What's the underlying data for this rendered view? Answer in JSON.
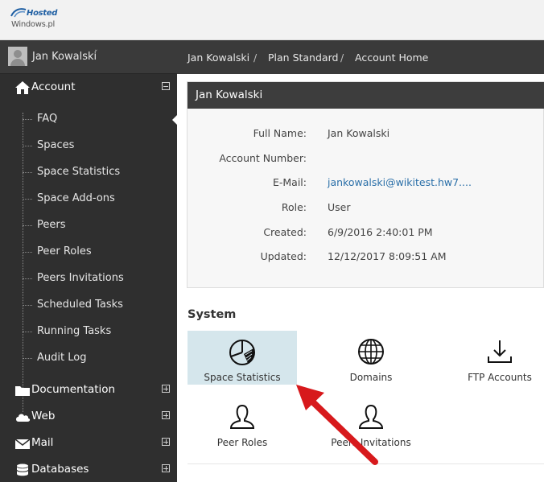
{
  "logo": {
    "line1": "Hosted",
    "line2": "Windows.pl"
  },
  "user": {
    "name": "Jan Kowalski",
    "caret": "ˇ"
  },
  "sidebar": {
    "account": {
      "label": "Account",
      "items": [
        "FAQ",
        "Spaces",
        "Space Statistics",
        "Space Add-ons",
        "Peers",
        "Peer Roles",
        "Peers Invitations",
        "Scheduled Tasks",
        "Running Tasks",
        "Audit Log"
      ]
    },
    "documentation": "Documentation",
    "web": "Web",
    "mail": "Mail",
    "databases": "Databases"
  },
  "breadcrumb": {
    "c1": "Jan Kowalski",
    "c2": "Plan Standard",
    "c3": "Account Home",
    "sep": "/"
  },
  "panel": {
    "title": "Jan Kowalski",
    "fields": [
      {
        "label": "Full Name:",
        "value": "Jan Kowalski"
      },
      {
        "label": "Account Number:",
        "value": ""
      },
      {
        "label": "E-Mail:",
        "value": "jankowalski@wikitest.hw7...."
      },
      {
        "label": "Role:",
        "value": "User"
      },
      {
        "label": "Created:",
        "value": "6/9/2016 2:40:01 PM"
      },
      {
        "label": "Updated:",
        "value": "12/12/2017 8:09:51 AM"
      }
    ]
  },
  "system": {
    "title": "System",
    "tiles": [
      "Space Statistics",
      "Domains",
      "FTP Accounts",
      "Peer Roles",
      "Peers Invitations"
    ]
  },
  "colors": {
    "sidebar": "#2f2f2f",
    "bar": "#3a3a3a",
    "selected_tile": "#d5e6ec",
    "link": "#2a6fa8",
    "arrow": "#d7191c"
  }
}
